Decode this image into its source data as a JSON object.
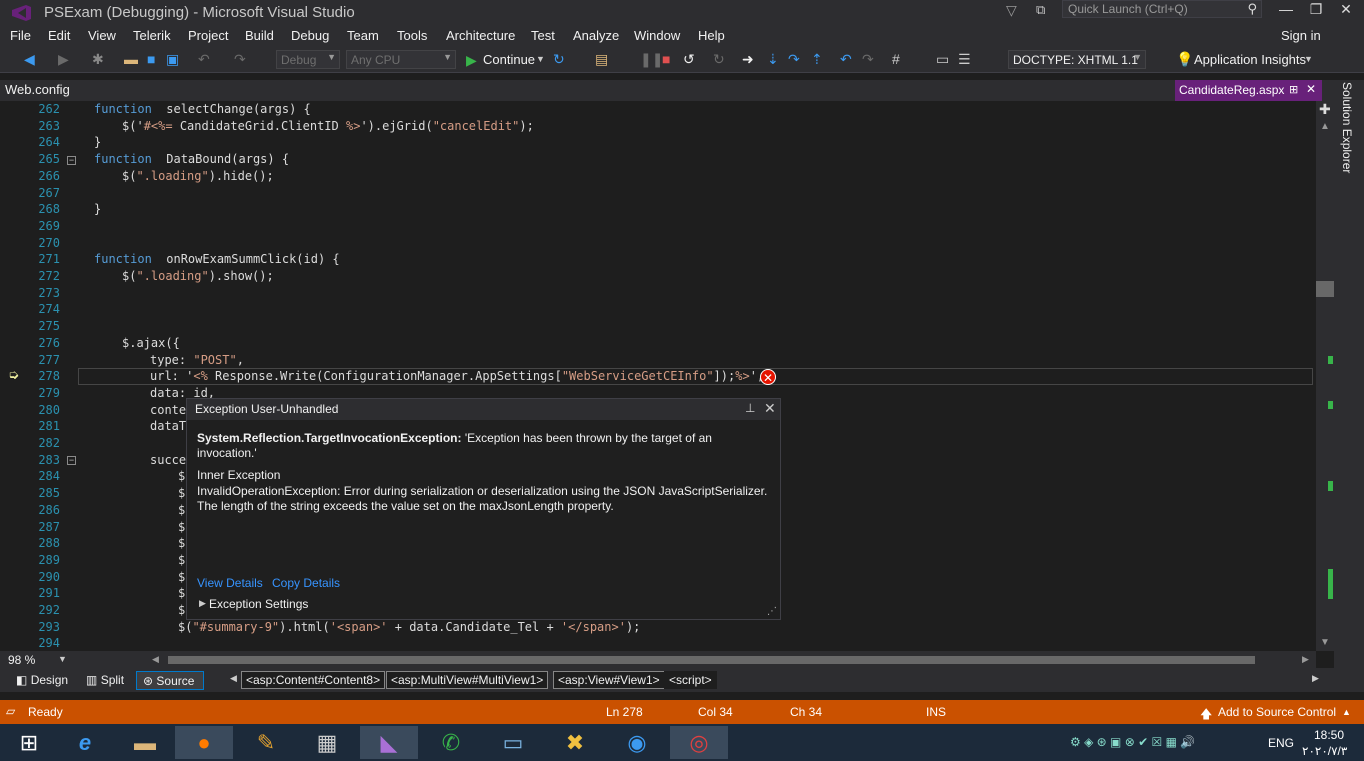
{
  "window": {
    "title": "PSExam (Debugging) - Microsoft Visual Studio",
    "quick_launch": "Quick Launch (Ctrl+Q)"
  },
  "menu": [
    "File",
    "Edit",
    "View",
    "Telerik",
    "Project",
    "Build",
    "Debug",
    "Team",
    "Tools",
    "Architecture",
    "Test",
    "Analyze",
    "Window",
    "Help"
  ],
  "signin": "Sign in",
  "toolbar": {
    "config": "Debug",
    "platform": "Any CPU",
    "continue": "Continue",
    "doctype": "DOCTYPE: XHTML 1.1",
    "insights": "Application Insights"
  },
  "tabs": {
    "left": "Web.config",
    "right": "CandidateReg.aspx"
  },
  "solution_explorer": "Solution Explorer",
  "lines": [
    {
      "n": "262",
      "indent": 0,
      "parts": [
        [
          "kw",
          "function"
        ],
        [
          "",
          "  selectChange(args) {"
        ]
      ]
    },
    {
      "n": "263",
      "indent": 1,
      "parts": [
        [
          "",
          "$('"
        ],
        [
          "str",
          "#<%= "
        ],
        [
          "",
          "CandidateGrid.ClientID "
        ],
        [
          "str",
          "%>"
        ],
        [
          "",
          "').ejGrid("
        ],
        [
          "str",
          "\"cancelEdit\""
        ],
        [
          "",
          ");"
        ]
      ]
    },
    {
      "n": "264",
      "indent": 0,
      "parts": [
        [
          "",
          "}"
        ]
      ]
    },
    {
      "n": "265",
      "indent": 0,
      "parts": [
        [
          "kw",
          "function"
        ],
        [
          "",
          "  DataBound(args) {"
        ]
      ]
    },
    {
      "n": "266",
      "indent": 1,
      "parts": [
        [
          "",
          "$("
        ],
        [
          "str",
          "\".loading\""
        ],
        [
          "",
          ").hide();"
        ]
      ]
    },
    {
      "n": "267",
      "indent": 0,
      "parts": []
    },
    {
      "n": "268",
      "indent": 0,
      "parts": [
        [
          "",
          "}"
        ]
      ]
    },
    {
      "n": "269",
      "indent": 0,
      "parts": []
    },
    {
      "n": "270",
      "indent": 0,
      "parts": []
    },
    {
      "n": "271",
      "indent": 0,
      "parts": [
        [
          "kw",
          "function"
        ],
        [
          "",
          "  onRowExamSummClick(id) {"
        ]
      ]
    },
    {
      "n": "272",
      "indent": 1,
      "parts": [
        [
          "",
          "$("
        ],
        [
          "str",
          "\".loading\""
        ],
        [
          "",
          ").show();"
        ]
      ]
    },
    {
      "n": "273",
      "indent": 0,
      "parts": []
    },
    {
      "n": "274",
      "indent": 0,
      "parts": []
    },
    {
      "n": "275",
      "indent": 0,
      "parts": []
    },
    {
      "n": "276",
      "indent": 1,
      "parts": [
        [
          "",
          "$.ajax({"
        ]
      ]
    },
    {
      "n": "277",
      "indent": 2,
      "parts": [
        [
          "",
          "type: "
        ],
        [
          "str",
          "\"POST\""
        ],
        [
          "",
          ","
        ]
      ]
    },
    {
      "n": "278",
      "indent": 2,
      "parts": [
        [
          "",
          "url: '"
        ],
        [
          "str",
          "<%"
        ],
        [
          "",
          " Response.Write(ConfigurationManager.AppSettings["
        ],
        [
          "str",
          "\"WebServiceGetCEInfo\""
        ],
        [
          "",
          "]);"
        ],
        [
          "str",
          "%>"
        ],
        [
          "",
          "',"
        ]
      ]
    },
    {
      "n": "279",
      "indent": 2,
      "parts": [
        [
          "",
          "data: id,"
        ]
      ]
    },
    {
      "n": "280",
      "indent": 2,
      "parts": [
        [
          "",
          "conte"
        ]
      ]
    },
    {
      "n": "281",
      "indent": 2,
      "parts": [
        [
          "",
          "dataT"
        ]
      ]
    },
    {
      "n": "282",
      "indent": 0,
      "parts": []
    },
    {
      "n": "283",
      "indent": 2,
      "parts": [
        [
          "",
          "succe"
        ]
      ]
    },
    {
      "n": "284",
      "indent": 3,
      "parts": [
        [
          "",
          "$"
        ]
      ]
    },
    {
      "n": "285",
      "indent": 3,
      "parts": [
        [
          "",
          "$"
        ]
      ]
    },
    {
      "n": "286",
      "indent": 3,
      "parts": [
        [
          "",
          "$"
        ]
      ]
    },
    {
      "n": "287",
      "indent": 3,
      "parts": [
        [
          "",
          "$"
        ]
      ]
    },
    {
      "n": "288",
      "indent": 3,
      "parts": [
        [
          "",
          "$"
        ]
      ]
    },
    {
      "n": "289",
      "indent": 3,
      "parts": [
        [
          "",
          "$"
        ]
      ]
    },
    {
      "n": "290",
      "indent": 3,
      "parts": [
        [
          "",
          "$"
        ]
      ]
    },
    {
      "n": "291",
      "indent": 3,
      "parts": [
        [
          "",
          "$"
        ]
      ]
    },
    {
      "n": "292",
      "indent": 3,
      "parts": [
        [
          "",
          "$"
        ]
      ]
    },
    {
      "n": "293",
      "indent": 3,
      "parts": [
        [
          "",
          "$("
        ],
        [
          "str",
          "\"#summary-9\""
        ],
        [
          "",
          ").html("
        ],
        [
          "str",
          "'<span>'"
        ],
        [
          "",
          " + data.Candidate_Tel + "
        ],
        [
          "str",
          "'</span>'"
        ],
        [
          "",
          ");"
        ]
      ]
    },
    {
      "n": "294",
      "indent": 0,
      "parts": []
    }
  ],
  "exception": {
    "header": "Exception User-Unhandled",
    "type": "System.Reflection.TargetInvocationException:",
    "message": " 'Exception has been thrown by the target of an invocation.'",
    "inner_label": "Inner Exception",
    "inner_text": "InvalidOperationException: Error during serialization or deserialization using the JSON JavaScriptSerializer. The length of the string exceeds the value set on the maxJsonLength property.",
    "view_details": "View Details",
    "copy_details": "Copy Details",
    "settings": "Exception Settings"
  },
  "zoom": "98 %",
  "views": {
    "design": "Design",
    "split": "Split",
    "source": "Source"
  },
  "breadcrumbs": [
    "<asp:Content#Content8>",
    "<asp:MultiView#MultiView1>",
    "<asp:View#View1>",
    "<script>"
  ],
  "status": {
    "ready": "Ready",
    "ln": "Ln 278",
    "col": "Col 34",
    "ch": "Ch 34",
    "ins": "INS",
    "source_control": "Add to Source Control"
  },
  "tray": {
    "lang": "ENG",
    "time": "18:50",
    "date": "۲۰۲۰/۷/۳"
  }
}
